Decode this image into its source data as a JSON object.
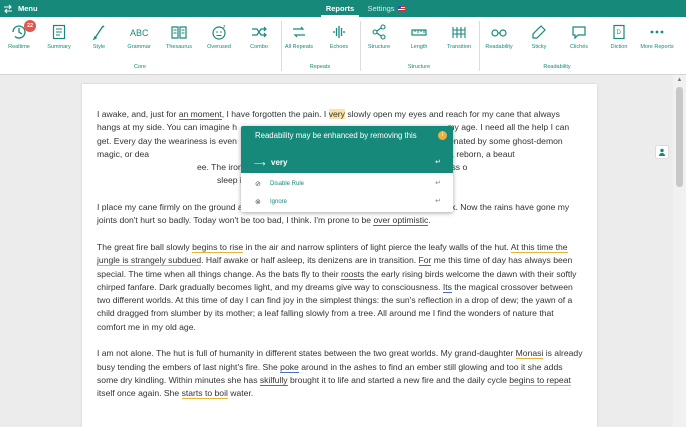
{
  "topbar": {
    "menu_label": "Menu",
    "tabs": [
      {
        "label": "Reports",
        "active": true
      },
      {
        "label": "Settings",
        "active": false
      }
    ]
  },
  "toolbar": {
    "groups": [
      {
        "label": "Core"
      },
      {
        "label": "Repeats"
      },
      {
        "label": "Structure"
      },
      {
        "label": "Readability"
      }
    ],
    "tools": [
      {
        "label": "Realtime",
        "icon": "realtime-icon",
        "badge": "22"
      },
      {
        "label": "Summary",
        "icon": "summary-icon"
      },
      {
        "label": "Style",
        "icon": "style-icon"
      },
      {
        "label": "Grammar",
        "icon": "grammar-icon"
      },
      {
        "label": "Thesaurus",
        "icon": "thesaurus-icon"
      },
      {
        "label": "Overused",
        "icon": "overused-icon"
      },
      {
        "label": "Combo",
        "icon": "combo-icon"
      },
      {
        "label": "All Repeats",
        "icon": "all-repeats-icon"
      },
      {
        "label": "Echoes",
        "icon": "echoes-icon"
      },
      {
        "label": "Structure",
        "icon": "structure-icon"
      },
      {
        "label": "Length",
        "icon": "length-icon"
      },
      {
        "label": "Transition",
        "icon": "transition-icon"
      },
      {
        "label": "Readability",
        "icon": "readability-icon"
      },
      {
        "label": "Sticky",
        "icon": "sticky-icon"
      },
      {
        "label": "Clichés",
        "icon": "cliches-icon"
      },
      {
        "label": "Diction",
        "icon": "diction-icon"
      },
      {
        "label": "More Reports",
        "icon": "more-reports-icon"
      }
    ]
  },
  "popup": {
    "title": "Readability may be enhanced by removing this",
    "suggestion": "very",
    "actions": [
      {
        "label": "Disable Rule",
        "icon": "disable-icon"
      },
      {
        "label": "Ignore",
        "icon": "ignore-icon"
      }
    ]
  },
  "document": {
    "p1": {
      "a": "I awake, and, just for ",
      "b": "an moment",
      "c": ", I have forgotten the pain. I ",
      "d": "very",
      "e": " slowly open my eyes and reach for my cane that always hangs at my side. You can imagine h",
      "f": " my age. I need all the help I can get. Every day the weariness is even",
      "g": " I hope I will awake, rejuvenated by some ghost-demon magic, or dea",
      "h": " my hammock as a cocoon from which I shall emerge, reborn, a beaut",
      "i": "ee. The irony is that, between the pain of my joints and the weakness o",
      "j": "sleep is a welcome luxury."
    },
    "p2": {
      "a": "I place my cane firmly on the ground and, slowly, with its aid, I lower myself from the hammock. Now the rains have gone my joints don't hurt so badly. Today won't be too bad, I think. I'm prone to be ",
      "b": "over optimistic",
      "c": "."
    },
    "p3": {
      "a": "The great fire ball slowly ",
      "b": "begins to rise",
      "c": " in the air and narrow splinters of light pierce the leafy walls of the hut. ",
      "d": "At this time the jungle is strangely subdued",
      "e": ". Half awake or half asleep, its denizens are in transition. ",
      "f": "For",
      "g": " me this time of day has always been special. The time when all things change. As the bats fly to their ",
      "h": "roosts",
      "i": " the early rising birds welcome the dawn with their softly chirped fanfare. Dark gradually becomes light, and my dreams give way to consciousness. ",
      "j": "Its",
      "k": " the magical crossover between two different worlds. At this time of day I can find joy in the simplest things: the sun's reflection in a drop of dew; the yawn of a child dragged from slumber by its mother; a leaf falling slowly from a tree. All around me I find the wonders of nature that comfort me in my old age."
    },
    "p4": {
      "a": "I am not alone. The hut is full of humanity in different states between the two great worlds. My grand-daughter ",
      "b": "Monasi",
      "c": " is already busy tending the embers of last night's fire. She ",
      "d": "poke",
      "e": " around in the ashes to find an ember still glowing and too it she adds some dry kindling. Within minutes she has ",
      "f": "skilfully",
      "g": " brought it to life and started a new fire and the daily cycle ",
      "h": "begins to repeat",
      "i": " itself once again. She ",
      "j": "starts to boil",
      "k": " water."
    }
  }
}
